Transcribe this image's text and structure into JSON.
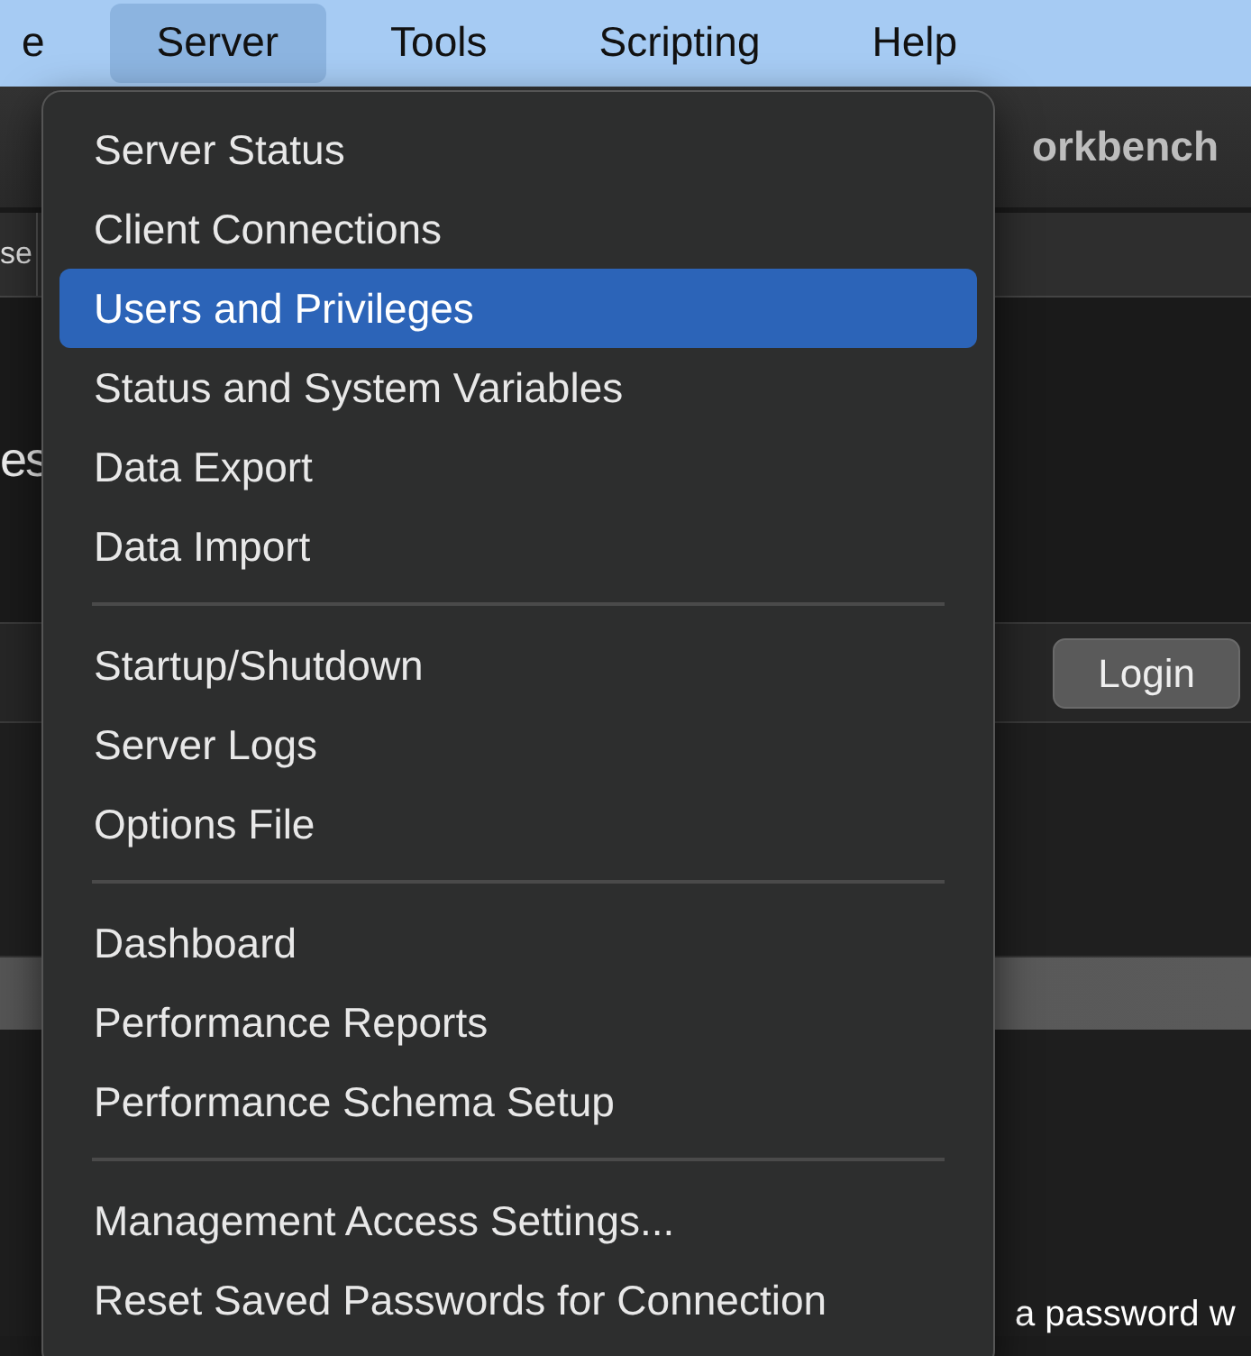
{
  "menu_bar": [
    {
      "label": "e",
      "selected": false
    },
    {
      "label": "Server",
      "selected": true
    },
    {
      "label": "Tools",
      "selected": false
    },
    {
      "label": "Scripting",
      "selected": false
    },
    {
      "label": "Help",
      "selected": false
    }
  ],
  "window": {
    "title": "orkbench",
    "tab": "se",
    "heading": "es",
    "login_button": "Login",
    "footer_text": "a password w"
  },
  "menu": {
    "groups": [
      [
        {
          "label": "Server Status",
          "selected": false
        },
        {
          "label": "Client Connections",
          "selected": false
        },
        {
          "label": "Users and Privileges",
          "selected": true
        },
        {
          "label": "Status and System Variables",
          "selected": false
        },
        {
          "label": "Data Export",
          "selected": false
        },
        {
          "label": "Data Import",
          "selected": false
        }
      ],
      [
        {
          "label": "Startup/Shutdown",
          "selected": false
        },
        {
          "label": "Server Logs",
          "selected": false
        },
        {
          "label": "Options File",
          "selected": false
        }
      ],
      [
        {
          "label": "Dashboard",
          "selected": false
        },
        {
          "label": "Performance Reports",
          "selected": false
        },
        {
          "label": "Performance Schema Setup",
          "selected": false
        }
      ],
      [
        {
          "label": "Management Access Settings...",
          "selected": false
        },
        {
          "label": "Reset Saved Passwords for Connection",
          "selected": false
        }
      ]
    ]
  }
}
